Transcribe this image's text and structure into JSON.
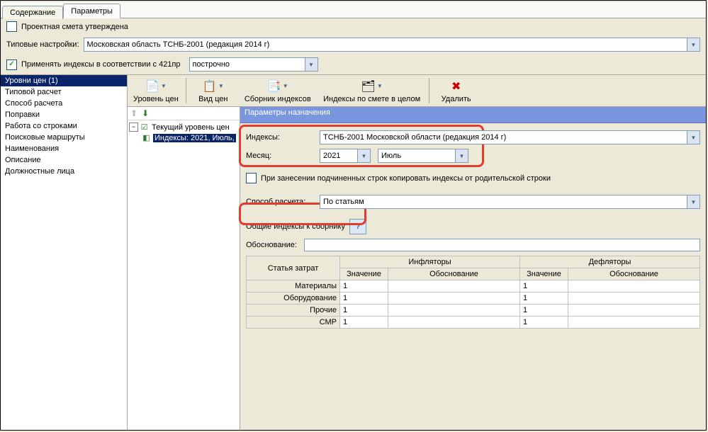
{
  "tabs": {
    "content": "Содержание",
    "params": "Параметры"
  },
  "approved": {
    "label": "Проектная смета утверждена",
    "checked": false
  },
  "typeSettings": {
    "label": "Типовые настройки:",
    "value": "Московская область ТСНБ-2001 (редакция 2014 г)"
  },
  "applyIdx": {
    "label": "Применять индексы в соответствии с 421пр",
    "checked": true,
    "ddvalue": "построчно"
  },
  "sidebar": {
    "items": [
      "Уровни цен (1)",
      "Типовой расчет",
      "Способ расчета",
      "Поправки",
      "Работа со строками",
      "Поисковые маршруты",
      "Наименования",
      "Описание",
      "Должностные лица"
    ],
    "selected": 0
  },
  "toolbar": {
    "level": "Уровень цен",
    "view": "Вид цен",
    "collection": "Сборник индексов",
    "whole": "Индексы по смете в целом",
    "delete": "Удалить"
  },
  "tree": {
    "root": "Текущий уровень цен",
    "child": "Индексы: 2021, Июль,"
  },
  "paramsHeader": "Параметры назначения",
  "idx": {
    "label": "Индексы:",
    "value": "ТСНБ-2001 Московской области (редакция 2014 г)"
  },
  "month": {
    "label": "Месяц:",
    "year": "2021",
    "mon": "Июль"
  },
  "copy": {
    "label": "При занесении подчиненных строк копировать индексы от родительской строки",
    "checked": false
  },
  "way": {
    "label": "Способ расчета:",
    "value": "По статьям"
  },
  "common": {
    "label": "Общие индексы к сборнику"
  },
  "just": {
    "label": "Обоснование:"
  },
  "table": {
    "colCost": "Статья затрат",
    "inf": "Инфляторы",
    "def": "Дефляторы",
    "val": "Значение",
    "jus": "Обоснование",
    "rows": [
      {
        "name": "Материалы",
        "iv": "1",
        "ij": "",
        "dv": "1",
        "dj": ""
      },
      {
        "name": "Оборудование",
        "iv": "1",
        "ij": "",
        "dv": "1",
        "dj": ""
      },
      {
        "name": "Прочие",
        "iv": "1",
        "ij": "",
        "dv": "1",
        "dj": ""
      },
      {
        "name": "СМР",
        "iv": "1",
        "ij": "",
        "dv": "1",
        "dj": ""
      }
    ]
  }
}
